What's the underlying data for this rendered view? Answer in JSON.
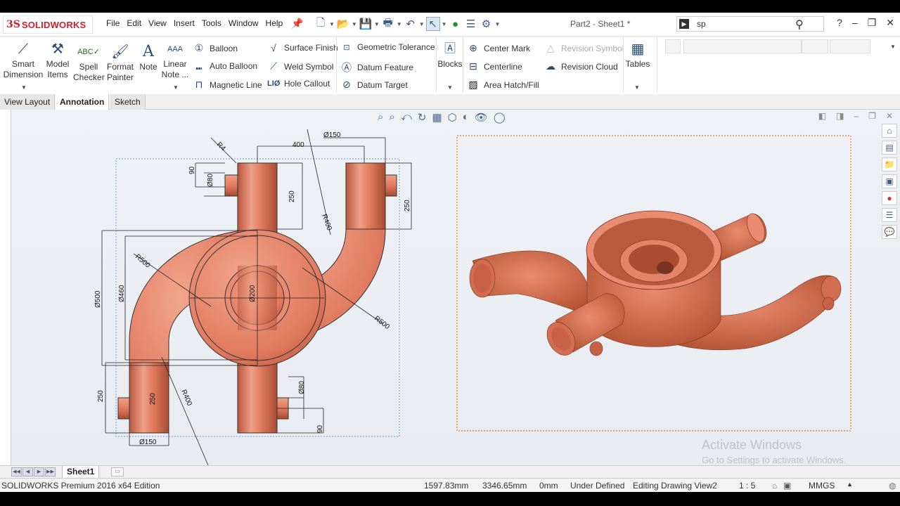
{
  "app": {
    "logo_prefix": "3S",
    "logo_text": "SOLIDWORKS",
    "doc_title": "Part2 - Sheet1 *"
  },
  "menu": [
    "File",
    "Edit",
    "View",
    "Insert",
    "Tools",
    "Window",
    "Help"
  ],
  "search": {
    "value": "sp"
  },
  "ribbon": {
    "smart_dimension": [
      "Smart",
      "Dimension"
    ],
    "model_items": [
      "Model",
      "Items"
    ],
    "spell_checker": [
      "Spell",
      "Checker"
    ],
    "format_painter": [
      "Format",
      "Painter"
    ],
    "note": "Note",
    "linear_note": [
      "Linear",
      "Note ..."
    ],
    "balloon": "Balloon",
    "auto_balloon": "Auto Balloon",
    "magnetic_line": "Magnetic Line",
    "surface_finish": "Surface Finish",
    "weld_symbol": "Weld Symbol",
    "hole_callout": "Hole Callout",
    "geometric_tolerance": "Geometric Tolerance",
    "datum_feature": "Datum Feature",
    "datum_target": "Datum Target",
    "blocks": "Blocks",
    "center_mark": "Center Mark",
    "centerline": "Centerline",
    "area_hatch": "Area Hatch/Fill",
    "revision_symbol": "Revision Symbol",
    "revision_cloud": "Revision Cloud",
    "tables": "Tables"
  },
  "tabs": [
    "View Layout",
    "Annotation",
    "Sketch"
  ],
  "drawing": {
    "dims": {
      "d150_top": "Ø150",
      "d400_top": "400",
      "r4": "R4",
      "d90_top": "90",
      "d80_top": "Ø80",
      "d250_left_pipe": "250",
      "r400_top": "R400",
      "d250_right": "250",
      "r500_left": "R500",
      "d500": "Ø500",
      "d460": "Ø460",
      "d200": "Ø200",
      "r500_right": "R500",
      "d250_bottom_left": "250",
      "d250_bottom_pipe": "250",
      "r400_bottom": "R400",
      "d80_bottom": "Ø80",
      "d90_bottom": "90",
      "d150_bottom": "Ø150"
    }
  },
  "watermark": {
    "line1": "Activate Windows",
    "line2": "Go to Settings to activate Windows."
  },
  "sheet": {
    "tab": "Sheet1"
  },
  "status": {
    "edition": "SOLIDWORKS Premium 2016 x64 Edition",
    "x": "1597.83mm",
    "y": "3346.65mm",
    "z": "0mm",
    "state": "Under Defined",
    "editing": "Editing Drawing View2",
    "scale": "1 : 5",
    "units": "MMGS"
  },
  "colors": {
    "part": "#e07a5f",
    "part_dark": "#b8573d",
    "dim_line": "#222222",
    "view_border": "#e07a2a",
    "logo": "#d0202a"
  }
}
